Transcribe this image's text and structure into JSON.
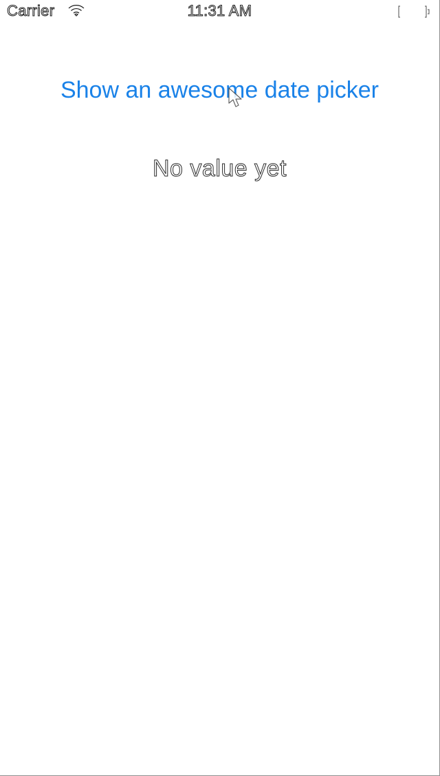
{
  "status_bar": {
    "carrier": "Carrier",
    "time": "11:31 AM",
    "wifi_icon": "wifi-icon",
    "battery_icon": "battery-icon"
  },
  "main": {
    "button_label": "Show an awesome date picker",
    "value_text": "No value yet"
  },
  "colors": {
    "accent": "#1a82e8",
    "background": "#ffffff"
  }
}
